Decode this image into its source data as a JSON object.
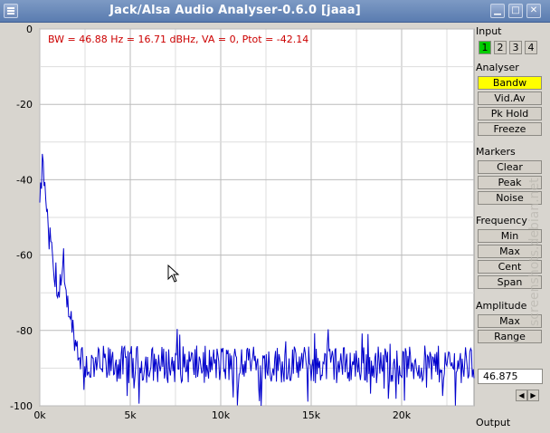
{
  "window": {
    "title": "Jack/Alsa Audio Analyser-0.6.0  [jaaa]"
  },
  "plot": {
    "info_text": "BW = 46.88 Hz = 16.71 dBHz, VA = 0, Ptot = -42.14",
    "trace_color": "#0000cc",
    "info_color": "#cc0000",
    "y_ticks": [
      "0",
      "-20",
      "-40",
      "-60",
      "-80",
      "-100"
    ],
    "x_ticks": [
      "0k",
      "5k",
      "10k",
      "15k",
      "20k"
    ]
  },
  "chart_data": {
    "type": "line",
    "title": "",
    "xlabel": "",
    "ylabel": "",
    "xlim": [
      0,
      24000
    ],
    "ylim": [
      -100,
      0
    ],
    "grid": true,
    "series": [
      {
        "x": [
          0,
          100,
          150,
          200,
          300,
          400,
          500,
          600,
          700,
          800,
          900,
          1000,
          1100,
          1200,
          1300,
          1400,
          1500,
          1600,
          1700,
          1800,
          1900,
          2000,
          2200,
          2400,
          2600,
          2800,
          3000,
          4000,
          5000,
          6000,
          8000,
          10000,
          12000,
          14000,
          16000,
          18000,
          20000,
          22000,
          24000
        ],
        "values": [
          -47,
          -40,
          -34,
          -38,
          -44,
          -48,
          -58,
          -54,
          -62,
          -66,
          -70,
          -68,
          -72,
          -67,
          -65,
          -70,
          -72,
          -74,
          -76,
          -78,
          -82,
          -84,
          -86,
          -88,
          -89,
          -90,
          -89,
          -89,
          -89,
          -89,
          -89,
          -89,
          -89,
          -89,
          -89,
          -89,
          -89,
          -89,
          -89
        ]
      }
    ]
  },
  "sidebar": {
    "input": {
      "label": "Input",
      "buttons": [
        "1",
        "2",
        "3",
        "4"
      ],
      "active": "1"
    },
    "analyser": {
      "label": "Analyser",
      "buttons": [
        "Bandw",
        "Vid.Av",
        "Pk Hold",
        "Freeze"
      ],
      "active": "Bandw"
    },
    "markers": {
      "label": "Markers",
      "buttons": [
        "Clear",
        "Peak",
        "Noise"
      ]
    },
    "frequency": {
      "label": "Frequency",
      "buttons": [
        "Min",
        "Max",
        "Cent",
        "Span"
      ]
    },
    "amplitude": {
      "label": "Amplitude",
      "buttons": [
        "Max",
        "Range"
      ]
    },
    "value": "46.875",
    "output_label": "Output"
  },
  "watermark": "screenshots.debian.net"
}
